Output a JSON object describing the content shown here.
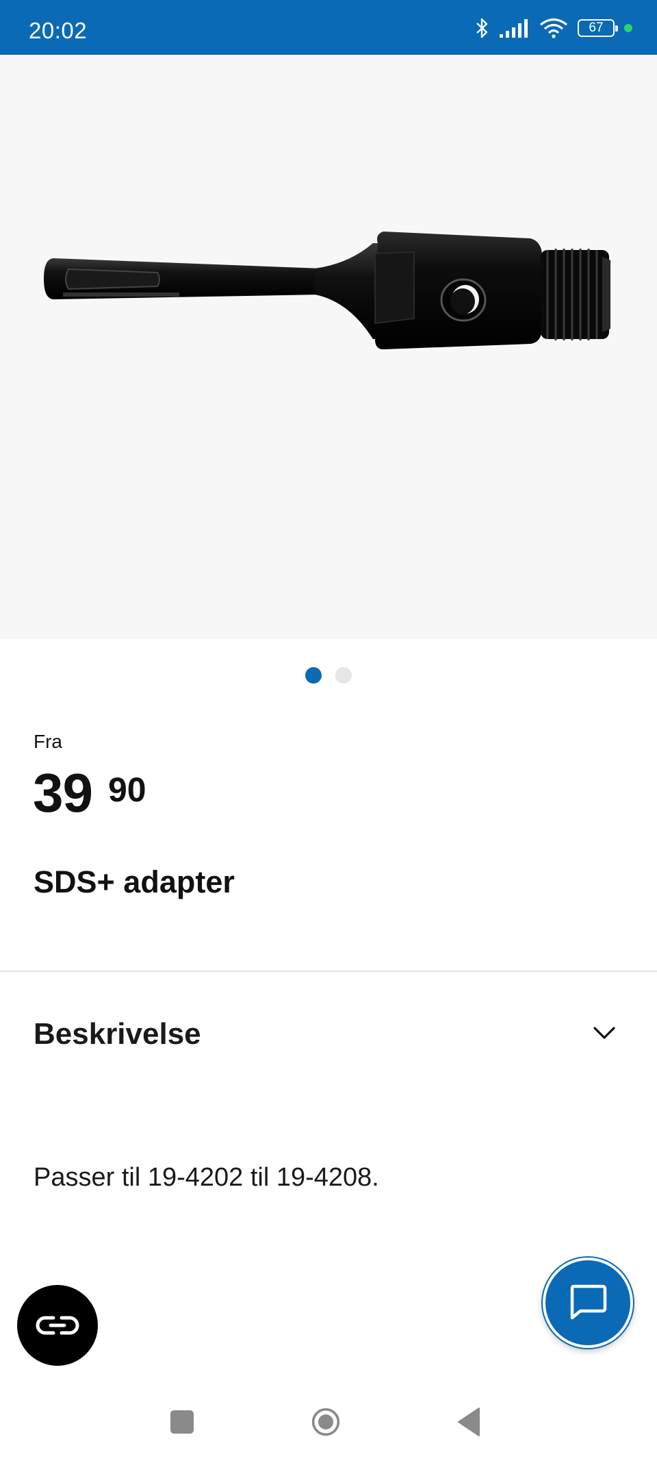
{
  "status_bar": {
    "time": "20:02",
    "battery_level": "67",
    "icons": [
      "bluetooth-icon",
      "signal-icon",
      "wifi-icon",
      "battery-icon",
      "notification-dot"
    ],
    "background_color": "#0a6ab5"
  },
  "hero": {
    "image": "sds-plus-adapter-product-image",
    "background_color": "#f7f7f7"
  },
  "carousel": {
    "total": 2,
    "active_index": 0,
    "active_color": "#0a6ab5"
  },
  "product": {
    "price_prefix": "Fra",
    "price_main": "39",
    "price_decimals": "90",
    "title": "SDS+ adapter"
  },
  "description": {
    "title": "Beskrivelse",
    "icon": "chevron-down-icon",
    "text": "Passer til 19-4202 til 19-4208."
  },
  "fabs": {
    "left_icon": "link-icon",
    "right_icon": "chat-icon"
  },
  "nav_bar": {
    "buttons": [
      "recents-square-icon",
      "home-circle-icon",
      "back-triangle-icon"
    ]
  }
}
